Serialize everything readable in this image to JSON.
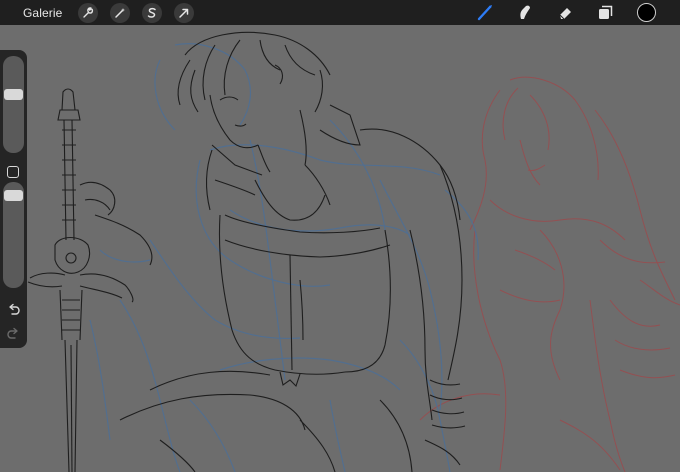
{
  "topbar": {
    "gallery_label": "Galerie",
    "left_tools": [
      {
        "icon": "wrench-icon",
        "name": "actions"
      },
      {
        "icon": "magic-wand-icon",
        "name": "adjustments"
      },
      {
        "icon": "selection-s-icon",
        "name": "selection"
      },
      {
        "icon": "arrow-cursor-icon",
        "name": "transform"
      }
    ],
    "right_tools": [
      {
        "icon": "brush-icon",
        "name": "paint",
        "active": true
      },
      {
        "icon": "smudge-icon",
        "name": "smudge"
      },
      {
        "icon": "eraser-icon",
        "name": "erase"
      },
      {
        "icon": "layers-icon",
        "name": "layers"
      }
    ],
    "active_color": "#000000",
    "accent_color": "#2d7cf6"
  },
  "sidebar": {
    "brush_size_level": 0.62,
    "brush_opacity_level": 0.92,
    "icons": [
      "modify-square-icon",
      "undo-icon",
      "redo-icon"
    ]
  },
  "colors": {
    "canvas": "#6d6d6d",
    "sketch_black": "#1e1e1e",
    "sketch_blue": "#4e6f95",
    "sketch_red": "#9a4b4e"
  }
}
